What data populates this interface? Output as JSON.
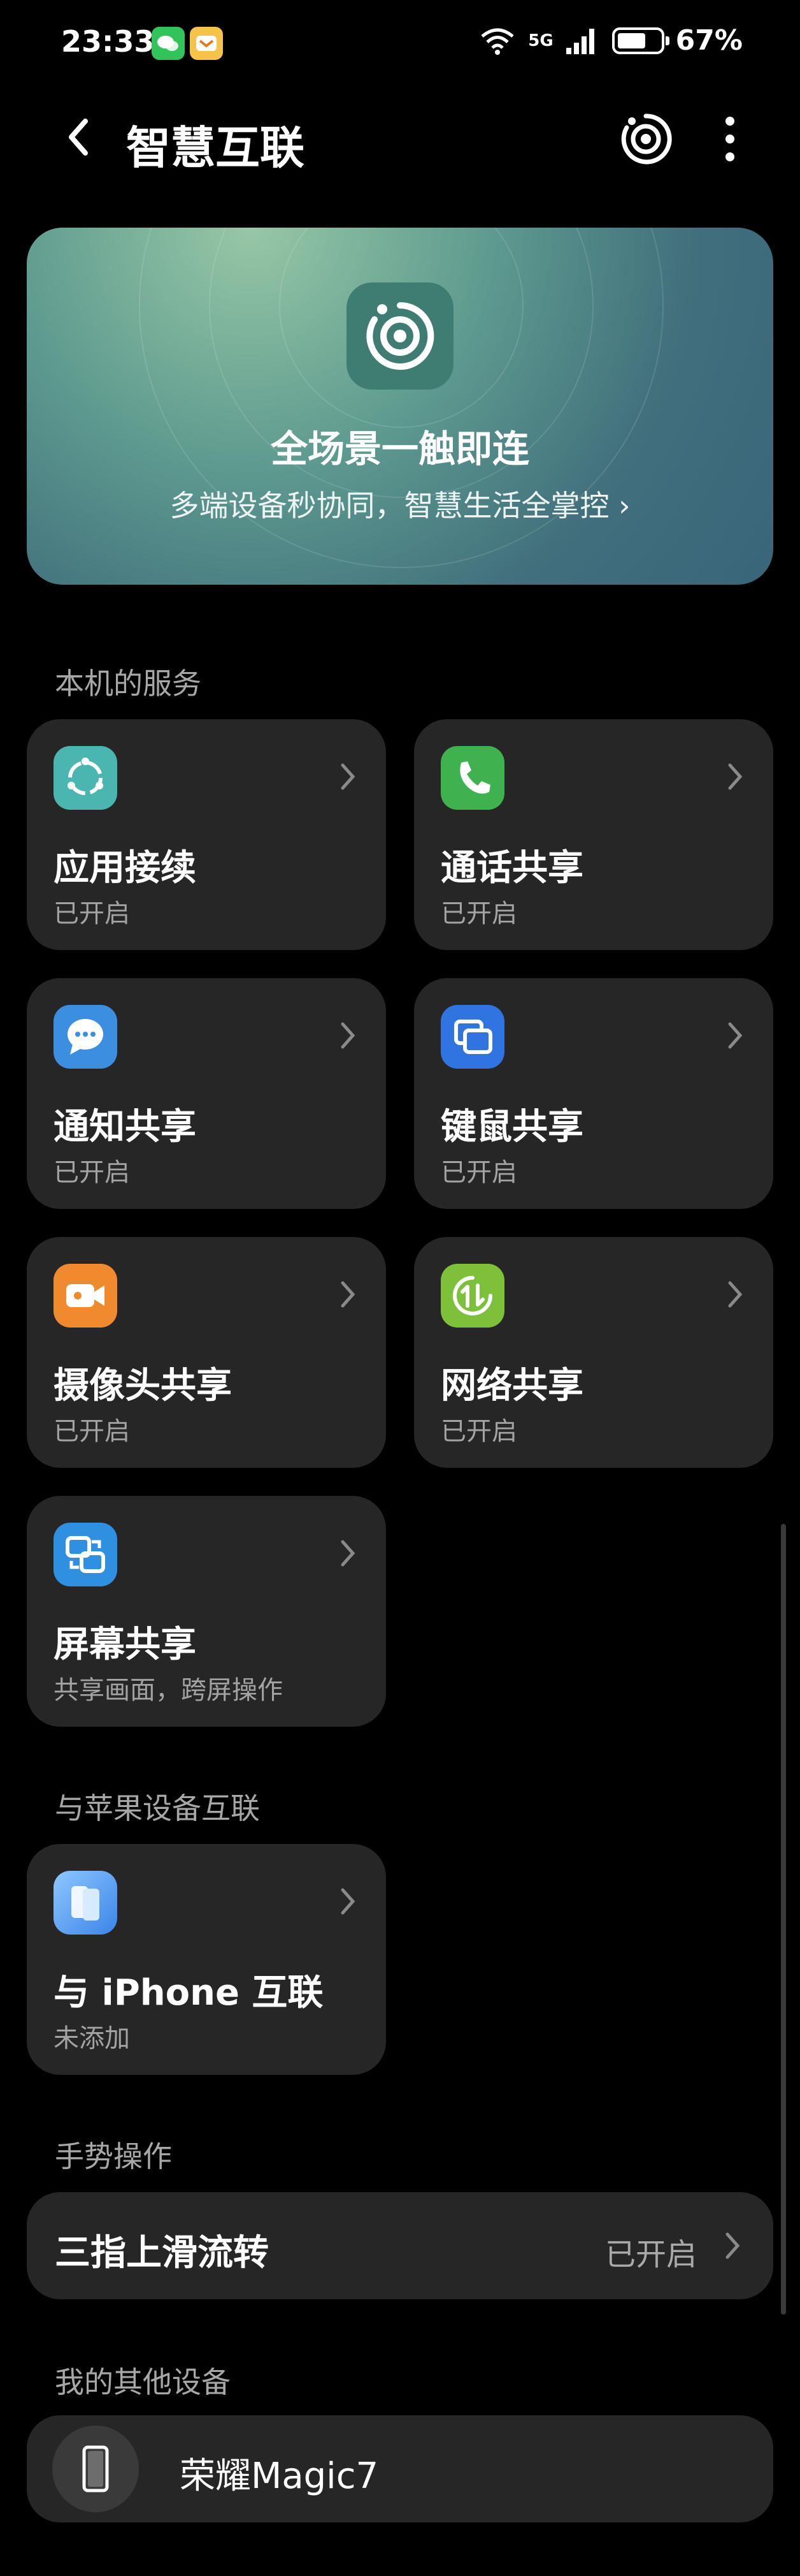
{
  "status_bar": {
    "time": "23:33",
    "network": "5G",
    "battery_percent": "67%",
    "battery_level": 0.67
  },
  "header": {
    "title": "智慧互联"
  },
  "hero": {
    "title": "全场景一触即连",
    "subtitle": "多端设备秒协同，智慧生活全掌控 ›"
  },
  "sections": {
    "local_services": "本机的服务",
    "apple": "与苹果设备互联",
    "gestures": "手势操作",
    "other_devices": "我的其他设备"
  },
  "services": [
    {
      "title": "应用接续",
      "status": "已开启",
      "icon": "app-relay-icon",
      "color": "#4bb5b0"
    },
    {
      "title": "通话共享",
      "status": "已开启",
      "icon": "phone-icon",
      "color": "#3fb24f"
    },
    {
      "title": "通知共享",
      "status": "已开启",
      "icon": "message-icon",
      "color": "#3c8fe0"
    },
    {
      "title": "键鼠共享",
      "status": "已开启",
      "icon": "keyboard-mouse-icon",
      "color": "#2f74e0"
    },
    {
      "title": "摄像头共享",
      "status": "已开启",
      "icon": "camera-icon",
      "color": "#ef8a2e"
    },
    {
      "title": "网络共享",
      "status": "已开启",
      "icon": "network-share-icon",
      "color": "#7dc03a"
    },
    {
      "title": "屏幕共享",
      "status": "共享画面，跨屏操作",
      "icon": "screen-share-icon",
      "color": "#2f8fe0"
    }
  ],
  "apple": {
    "title": "与 iPhone 互联",
    "status": "未添加",
    "icon": "iphone-icon"
  },
  "gesture": {
    "label": "三指上滑流转",
    "value": "已开启"
  },
  "device": {
    "name": "荣耀Magic7",
    "icon": "phone-device-icon"
  },
  "colors": {
    "background": "#000000",
    "card": "#262626",
    "secondary_text": "#a3a3a3"
  }
}
